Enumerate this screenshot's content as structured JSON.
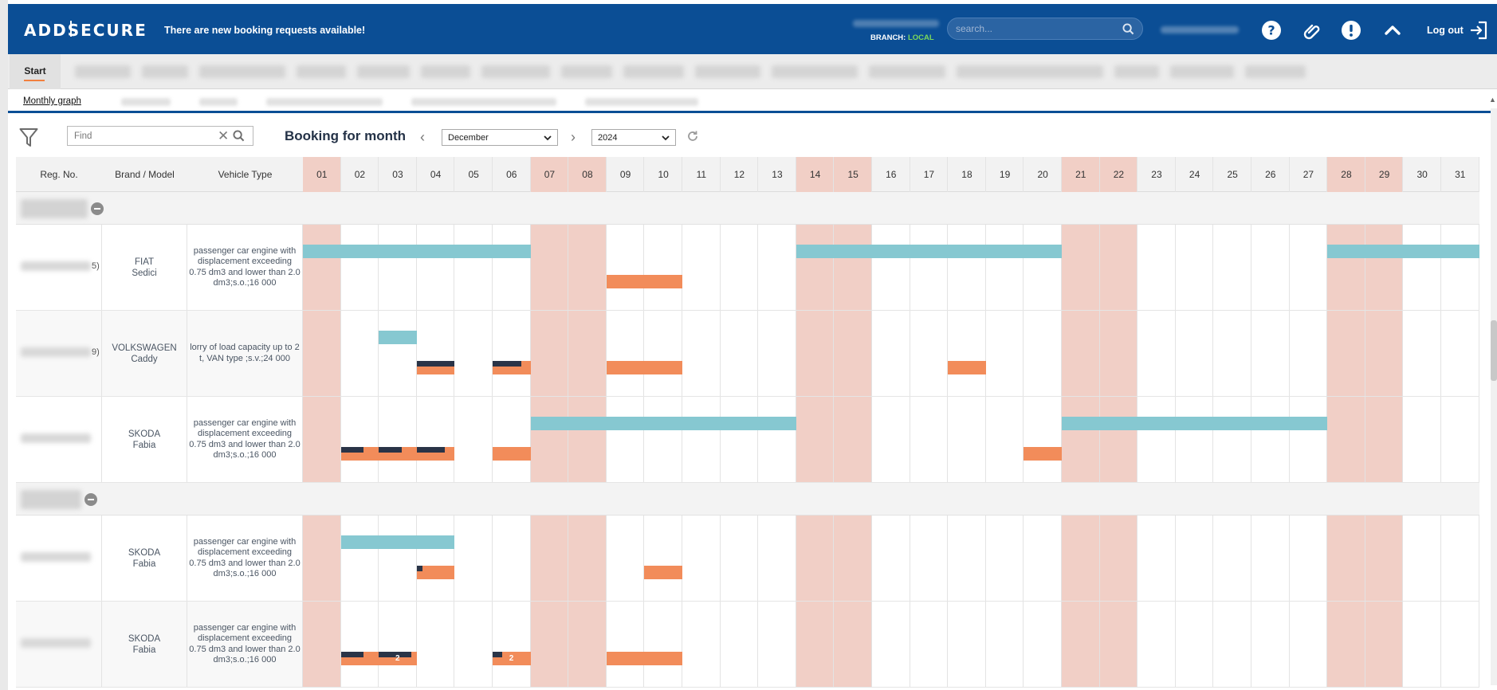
{
  "header": {
    "logo": "ADDSECURE",
    "notice": "There are new booking requests available!",
    "branch_label": "BRANCH:",
    "branch_value": "LOCAL",
    "search_placeholder": "search...",
    "logout_label": "Log out"
  },
  "tabs": {
    "start_label": "Start"
  },
  "subtabs": {
    "monthly_graph": "Monthly graph"
  },
  "toolbar": {
    "find_placeholder": "Find",
    "title": "Booking for month",
    "month": "December",
    "year": "2024"
  },
  "columns": {
    "reg": "Reg. No.",
    "brand": "Brand / Model",
    "type": "Vehicle Type"
  },
  "days": [
    "01",
    "02",
    "03",
    "04",
    "05",
    "06",
    "07",
    "08",
    "09",
    "10",
    "11",
    "12",
    "13",
    "14",
    "15",
    "16",
    "17",
    "18",
    "19",
    "20",
    "21",
    "22",
    "23",
    "24",
    "25",
    "26",
    "27",
    "28",
    "29",
    "30",
    "31"
  ],
  "weekend_days": [
    1,
    7,
    8,
    14,
    15,
    21,
    22,
    28,
    29
  ],
  "groups": [
    {
      "vehicles": [
        {
          "reg_tail": "5)",
          "brand": "FIAT",
          "model": "Sedici",
          "type": "passenger car engine with displacement exceeding 0.75 dm3 and lower than 2.0 dm3;s.o.;16 000",
          "bars": [
            {
              "kind": "teal",
              "start": 1,
              "end": 6,
              "lane": 0
            },
            {
              "kind": "teal",
              "start": 14,
              "end": 20,
              "lane": 0
            },
            {
              "kind": "teal",
              "start": 28,
              "end": 31,
              "lane": 0
            },
            {
              "kind": "orange",
              "start": 9,
              "end": 10,
              "lane": 1
            }
          ]
        },
        {
          "reg_tail": "9)",
          "brand": "VOLKSWAGEN",
          "model": "Caddy",
          "type": "lorry of load capacity up to 2 t, VAN type ;s.v.;24 000",
          "bars": [
            {
              "kind": "teal",
              "start": 3,
              "end": 3,
              "lane": 0
            },
            {
              "kind": "orange",
              "start": 4,
              "end": 4,
              "lane": 1,
              "navy": 1
            },
            {
              "kind": "orange",
              "start": 6,
              "end": 6,
              "lane": 1,
              "navy": 0.75
            },
            {
              "kind": "orange",
              "start": 9,
              "end": 10,
              "lane": 1
            },
            {
              "kind": "orange",
              "start": 18,
              "end": 18,
              "lane": 1
            }
          ]
        },
        {
          "reg_tail": "",
          "brand": "SKODA",
          "model": "Fabia",
          "type": "passenger car engine with displacement exceeding 0.75 dm3 and lower than 2.0 dm3;s.o.;16 000",
          "bars": [
            {
              "kind": "teal",
              "start": 7,
              "end": 13,
              "lane": 0
            },
            {
              "kind": "teal",
              "start": 21,
              "end": 27,
              "lane": 0
            },
            {
              "kind": "orange",
              "start": 2,
              "end": 2,
              "lane": 1,
              "navy": 0.6
            },
            {
              "kind": "orange",
              "start": 3,
              "end": 3,
              "lane": 1,
              "navy": 0.6
            },
            {
              "kind": "orange",
              "start": 4,
              "end": 4,
              "lane": 1,
              "navy": 0.75
            },
            {
              "kind": "orange",
              "start": 6,
              "end": 6,
              "lane": 1
            },
            {
              "kind": "orange",
              "start": 20,
              "end": 20,
              "lane": 1
            }
          ]
        }
      ]
    },
    {
      "vehicles": [
        {
          "reg_tail": "",
          "brand": "SKODA",
          "model": "Fabia",
          "type": "passenger car engine with displacement exceeding 0.75 dm3 and lower than 2.0 dm3;s.o.;16 000",
          "bars": [
            {
              "kind": "teal",
              "start": 2,
              "end": 4,
              "lane": 0
            },
            {
              "kind": "orange",
              "start": 4,
              "end": 4,
              "lane": 1,
              "navy": 0.15
            },
            {
              "kind": "orange",
              "start": 10,
              "end": 10,
              "lane": 1
            }
          ]
        },
        {
          "reg_tail": "",
          "brand": "SKODA",
          "model": "Fabia",
          "type": "passenger car engine with displacement exceeding 0.75 dm3 and lower than 2.0 dm3;s.o.;16 000",
          "bars": [
            {
              "kind": "orange",
              "start": 2,
              "end": 2,
              "lane": 1,
              "navy": 0.6
            },
            {
              "kind": "orange",
              "start": 3,
              "end": 3,
              "lane": 1,
              "navy": 0.85,
              "label": "2"
            },
            {
              "kind": "orange",
              "start": 6,
              "end": 6,
              "lane": 1,
              "navy": 0.25,
              "label": "2"
            },
            {
              "kind": "orange",
              "start": 9,
              "end": 10,
              "lane": 1
            }
          ]
        }
      ]
    }
  ]
}
